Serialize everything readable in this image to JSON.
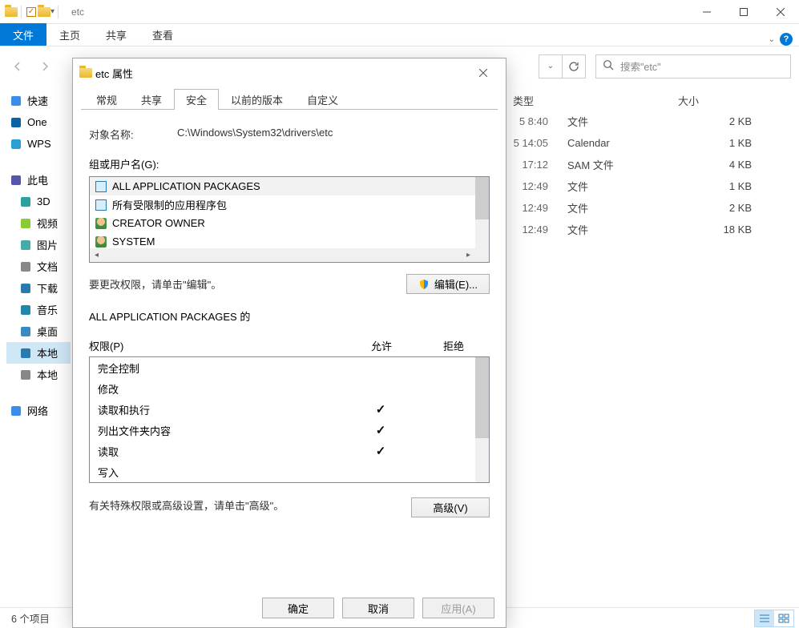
{
  "explorer": {
    "title": "etc",
    "ribbon": {
      "file": "文件",
      "home": "主页",
      "share": "共享",
      "view": "查看"
    },
    "search_placeholder": "搜索\"etc\"",
    "sidebar": [
      {
        "label": "快速",
        "icon": "star"
      },
      {
        "label": "One",
        "icon": "cloud"
      },
      {
        "label": "WPS",
        "icon": "cloud2"
      },
      {
        "label": "此电",
        "icon": "pc",
        "gap_before": true
      },
      {
        "label": "3D",
        "icon": "cube",
        "indent": true
      },
      {
        "label": "视频",
        "icon": "film",
        "indent": true
      },
      {
        "label": "图片",
        "icon": "pic",
        "indent": true
      },
      {
        "label": "文档",
        "icon": "doc",
        "indent": true
      },
      {
        "label": "下载",
        "icon": "down",
        "indent": true
      },
      {
        "label": "音乐",
        "icon": "music",
        "indent": true
      },
      {
        "label": "桌面",
        "icon": "desk",
        "indent": true
      },
      {
        "label": "本地",
        "icon": "win",
        "indent": true,
        "selected": true
      },
      {
        "label": "本地",
        "icon": "drive",
        "indent": true
      },
      {
        "label": "网络",
        "icon": "net",
        "gap_before": true
      }
    ],
    "columns": {
      "type": "类型",
      "size": "大小"
    },
    "rows": [
      {
        "date": "5 8:40",
        "type": "文件",
        "size": "2 KB"
      },
      {
        "date": "5 14:05",
        "type": "Calendar",
        "size": "1 KB"
      },
      {
        "date": "17:12",
        "type": "SAM 文件",
        "size": "4 KB"
      },
      {
        "date": "12:49",
        "type": "文件",
        "size": "1 KB"
      },
      {
        "date": "12:49",
        "type": "文件",
        "size": "2 KB"
      },
      {
        "date": "12:49",
        "type": "文件",
        "size": "18 KB"
      }
    ],
    "status": "6 个项目"
  },
  "props": {
    "title": "etc 属性",
    "tabs": {
      "general": "常规",
      "sharing": "共享",
      "security": "安全",
      "prev": "以前的版本",
      "custom": "自定义"
    },
    "object_label": "对象名称:",
    "object_value": "C:\\Windows\\System32\\drivers\\etc",
    "groups_label": "组或用户名(G):",
    "principals": [
      {
        "name": "ALL APPLICATION PACKAGES",
        "icon": "pkg",
        "selected": true
      },
      {
        "name": "所有受限制的应用程序包",
        "icon": "pkg"
      },
      {
        "name": "CREATOR OWNER",
        "icon": "user"
      },
      {
        "name": "SYSTEM",
        "icon": "user"
      }
    ],
    "edit_hint": "要更改权限，请单击\"编辑\"。",
    "edit_btn": "编辑(E)...",
    "perm_title1": "ALL APPLICATION PACKAGES 的",
    "perm_title2": "权限(P)",
    "col_allow": "允许",
    "col_deny": "拒绝",
    "perms": [
      {
        "name": "完全控制",
        "allow": false
      },
      {
        "name": "修改",
        "allow": false
      },
      {
        "name": "读取和执行",
        "allow": true
      },
      {
        "name": "列出文件夹内容",
        "allow": true
      },
      {
        "name": "读取",
        "allow": true
      },
      {
        "name": "写入",
        "allow": false
      }
    ],
    "adv_hint": "有关特殊权限或高级设置，请单击\"高级\"。",
    "adv_btn": "高级(V)",
    "ok": "确定",
    "cancel": "取消",
    "apply": "应用(A)"
  }
}
